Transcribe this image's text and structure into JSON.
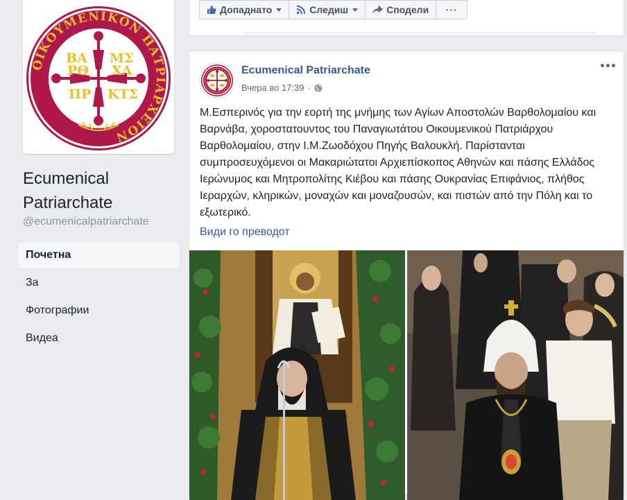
{
  "page": {
    "name": "Ecumenical Patriarchate",
    "handle": "@ecumenicalpatriarchate",
    "logo_text": "ΟΙΚΟΥΜΕΝΙΚΟΝ ΠΑΤΡΙΑΡΧΕΙΟΝ",
    "logo_monograms": [
      "ΒΑ",
      "ΡΘ",
      "ΜΣ",
      "ΧΛ",
      "ΠΡ",
      "ΚΤΣ"
    ]
  },
  "nav": {
    "items": [
      {
        "label": "Почетна",
        "active": true
      },
      {
        "label": "За",
        "active": false
      },
      {
        "label": "Фотографии",
        "active": false
      },
      {
        "label": "Видеа",
        "active": false
      }
    ]
  },
  "actions": {
    "like_label": "Допаднато",
    "follow_label": "Следиш",
    "share_label": "Сподели",
    "more_label": "···"
  },
  "post": {
    "author": "Ecumenical Patriarchate",
    "time": "Вчера во 17:39",
    "privacy_icon": "globe-icon",
    "text": "Μ.Εσπερινός για την εορτή της μνήμης των Αγίων Αποστολών Βαρθολομαίου και Βαρνάβα, χοροστατουντος του Παναγιωτάτου Οικουμενικού Πατριάρχου Βαρθολομαίου, στην Ι.Μ.Ζωοδόχου Πηγής Βαλουκλή. Παρίστανται συμπροσευχόμενοι οι Μακαριώτατοι Αρχιεπίσκοπος Αθηνών και πάσης Ελλάδος Ιερώνυμος και Μητροπολίτης Κιέβου και πάσης Ουκρανίας Επιφάνιος, πλήθος Ιεραρχών, κληρικών, μοναχών και μοναζουσών, και πιστών από την Πόλη και το εξωτερικό.",
    "translate_label": "Види го преводот"
  },
  "colors": {
    "background": "#e9ebee",
    "link": "#365899",
    "logo_crimson": "#b0174a",
    "logo_gold": "#e8c12a"
  }
}
